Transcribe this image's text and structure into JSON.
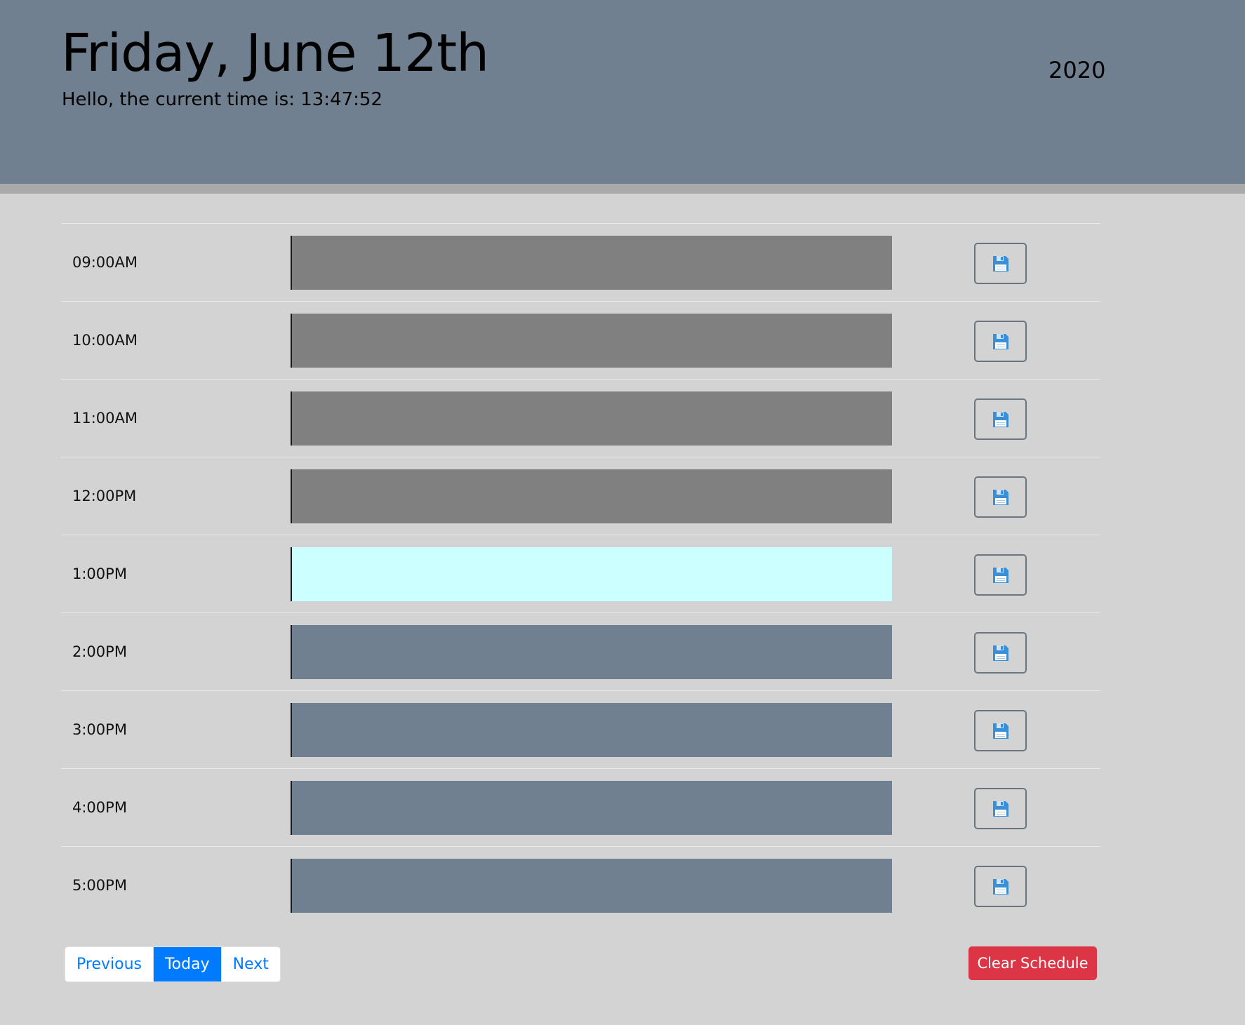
{
  "header": {
    "date_title": "Friday, June 12th",
    "current_time_text": "Hello, the current time is: 13:47:52",
    "year": "2020"
  },
  "colors": {
    "header_bg": "#708090",
    "page_bg": "#d3d3d3",
    "past": "#808080",
    "present": "#ccffff",
    "future": "#708090",
    "save_icon": "#3a8fd6",
    "pager_active": "#007bff",
    "clear_button": "#dc3545"
  },
  "schedule": {
    "rows": [
      {
        "hour": "09:00AM",
        "status": "past",
        "event": ""
      },
      {
        "hour": "10:00AM",
        "status": "past",
        "event": ""
      },
      {
        "hour": "11:00AM",
        "status": "past",
        "event": ""
      },
      {
        "hour": "12:00PM",
        "status": "past",
        "event": ""
      },
      {
        "hour": "1:00PM",
        "status": "present",
        "event": ""
      },
      {
        "hour": "2:00PM",
        "status": "future",
        "event": ""
      },
      {
        "hour": "3:00PM",
        "status": "future",
        "event": ""
      },
      {
        "hour": "4:00PM",
        "status": "future",
        "event": ""
      },
      {
        "hour": "5:00PM",
        "status": "future",
        "event": ""
      }
    ],
    "save_icon": "floppy-disk-icon"
  },
  "pager": {
    "previous_label": "Previous",
    "today_label": "Today",
    "next_label": "Next"
  },
  "actions": {
    "clear_label": "Clear Schedule"
  }
}
